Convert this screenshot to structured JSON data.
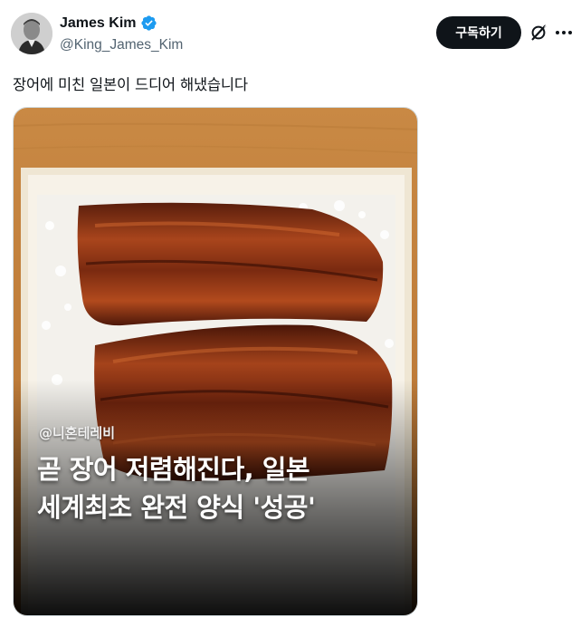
{
  "author": {
    "name": "James Kim",
    "handle": "@King_James_Kim",
    "verified_color": "#1d9bf0"
  },
  "header": {
    "subscribe_label": "구독하기",
    "grok_icon": "grok-icon",
    "more_icon": "more-icon"
  },
  "tweet": {
    "text": "장어에 미친 일본이 드디어 해냈습니다"
  },
  "media": {
    "channel": "@니혼테레비",
    "headline_line1": "곧 장어 저렴해진다, 일본",
    "headline_line2": "세계최초 완전 양식 '성공'"
  }
}
